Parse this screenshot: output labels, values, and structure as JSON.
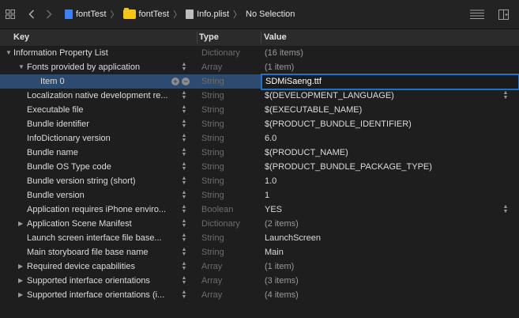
{
  "jumpbar": {
    "icons": [
      "grid-icon",
      "back-chevron-icon",
      "forward-chevron-icon"
    ],
    "crumbs": [
      {
        "label": "fontTest",
        "icon": "swift-project-icon"
      },
      {
        "label": "fontTest",
        "icon": "folder-icon"
      },
      {
        "label": "Info.plist",
        "icon": "plist-file-icon"
      },
      {
        "label": "No Selection",
        "icon": ""
      }
    ],
    "right_icons": [
      "lines-icon",
      "add-editor-icon"
    ]
  },
  "columns": {
    "key": "Key",
    "type": "Type",
    "value": "Value"
  },
  "rows": [
    {
      "key": "Information Property List",
      "type": "Dictionary",
      "value": "(16 items)",
      "indent": 0,
      "disclosure": "expanded",
      "stepper": false,
      "value_muted": true
    },
    {
      "key": "Fonts provided by application",
      "type": "Array",
      "value": "(1 item)",
      "indent": 1,
      "disclosure": "expanded",
      "stepper": true,
      "value_muted": true
    },
    {
      "key": "Item 0",
      "type": "String",
      "value": "SDMiSaeng.ttf",
      "indent": 3,
      "disclosure": "",
      "stepper": false,
      "selected": true,
      "editing": true
    },
    {
      "key": "Localization native development re...",
      "type": "String",
      "value": "$(DEVELOPMENT_LANGUAGE)",
      "indent": 1,
      "disclosure": "",
      "stepper": true,
      "value_stepper": true
    },
    {
      "key": "Executable file",
      "type": "String",
      "value": "$(EXECUTABLE_NAME)",
      "indent": 1,
      "disclosure": "",
      "stepper": true
    },
    {
      "key": "Bundle identifier",
      "type": "String",
      "value": "$(PRODUCT_BUNDLE_IDENTIFIER)",
      "indent": 1,
      "disclosure": "",
      "stepper": true
    },
    {
      "key": "InfoDictionary version",
      "type": "String",
      "value": "6.0",
      "indent": 1,
      "disclosure": "",
      "stepper": true
    },
    {
      "key": "Bundle name",
      "type": "String",
      "value": "$(PRODUCT_NAME)",
      "indent": 1,
      "disclosure": "",
      "stepper": true
    },
    {
      "key": "Bundle OS Type code",
      "type": "String",
      "value": "$(PRODUCT_BUNDLE_PACKAGE_TYPE)",
      "indent": 1,
      "disclosure": "",
      "stepper": true
    },
    {
      "key": "Bundle version string (short)",
      "type": "String",
      "value": "1.0",
      "indent": 1,
      "disclosure": "",
      "stepper": true
    },
    {
      "key": "Bundle version",
      "type": "String",
      "value": "1",
      "indent": 1,
      "disclosure": "",
      "stepper": true
    },
    {
      "key": "Application requires iPhone enviro...",
      "type": "Boolean",
      "value": "YES",
      "indent": 1,
      "disclosure": "",
      "stepper": true,
      "value_stepper": true
    },
    {
      "key": "Application Scene Manifest",
      "type": "Dictionary",
      "value": "(2 items)",
      "indent": 1,
      "disclosure": "collapsed",
      "stepper": true,
      "value_muted": true
    },
    {
      "key": "Launch screen interface file base...",
      "type": "String",
      "value": "LaunchScreen",
      "indent": 1,
      "disclosure": "",
      "stepper": true
    },
    {
      "key": "Main storyboard file base name",
      "type": "String",
      "value": "Main",
      "indent": 1,
      "disclosure": "",
      "stepper": true
    },
    {
      "key": "Required device capabilities",
      "type": "Array",
      "value": "(1 item)",
      "indent": 1,
      "disclosure": "collapsed",
      "stepper": true,
      "value_muted": true
    },
    {
      "key": "Supported interface orientations",
      "type": "Array",
      "value": "(3 items)",
      "indent": 1,
      "disclosure": "collapsed",
      "stepper": true,
      "value_muted": true
    },
    {
      "key": "Supported interface orientations (i...",
      "type": "Array",
      "value": "(4 items)",
      "indent": 1,
      "disclosure": "collapsed",
      "stepper": true,
      "value_muted": true
    }
  ],
  "colors": {
    "selection": "#2d4a70",
    "edit_border": "#1f6fcf",
    "background": "#1e1e1e"
  }
}
